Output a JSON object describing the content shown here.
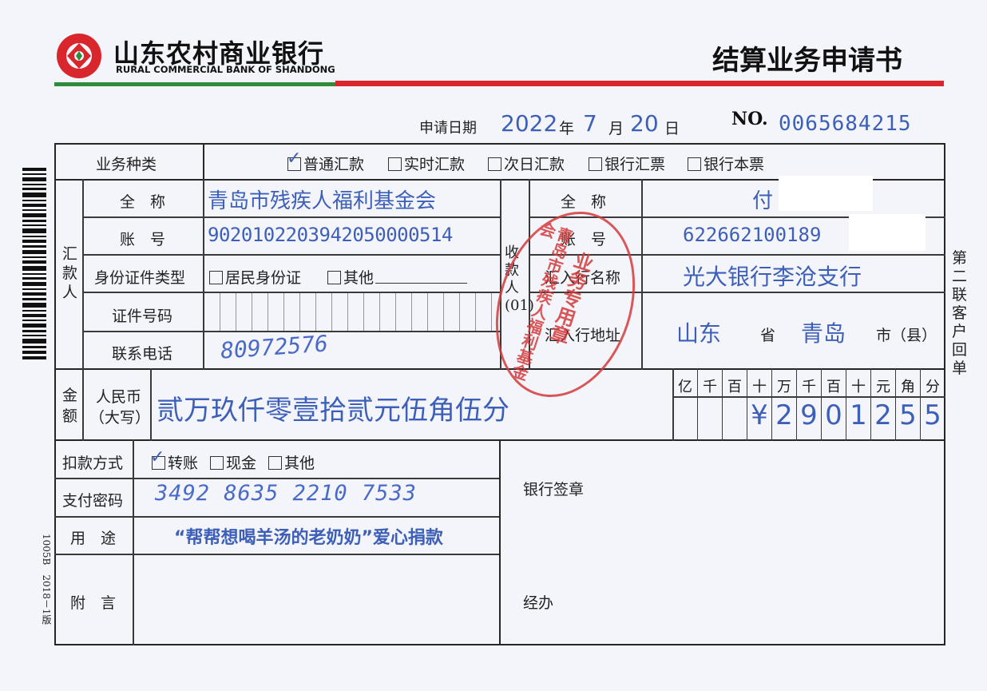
{
  "bank": {
    "name_cn": "山东农村商业银行",
    "name_en": "RURAL COMMERCIAL BANK OF SHANDONG",
    "colors": {
      "red": "#d9262c",
      "green": "#2e8b3a",
      "ink": "#3d5fb8"
    }
  },
  "doc_title": "结算业务申请书",
  "header": {
    "date_label": "申请日期",
    "year": "2022",
    "year_unit": "年",
    "month": "7",
    "month_unit": "月",
    "day": "20",
    "day_unit": "日",
    "no_label": "NO.",
    "no_value": "0065684215"
  },
  "business_type": {
    "label": "业务种类",
    "options": [
      "普通汇款",
      "实时汇款",
      "次日汇款",
      "银行汇票",
      "银行本票"
    ],
    "checked": "普通汇款"
  },
  "remitter": {
    "section_label": "汇款人",
    "name_label": "全　称",
    "name": "青岛市残疾人福利基金会",
    "account_label": "账　号",
    "account": "902010220394205000051​4",
    "id_type_label": "身份证件类型",
    "id_type_options": [
      "居民身份证",
      "其他"
    ],
    "id_no_label": "证件号码",
    "phone_label": "联系电话",
    "phone": "80972576"
  },
  "payee": {
    "section_label": "收款人(01)",
    "name_label": "全　称",
    "name": "付",
    "account_label": "账　号",
    "account": "622662100189",
    "bank_label": "汇入行名称",
    "bank": "光大银行李沧支行",
    "address_label": "汇入行地址",
    "province": "山东",
    "province_unit": "省",
    "city": "青岛",
    "city_unit": "市（县）"
  },
  "amount": {
    "label": "金额",
    "currency_label": "人民币",
    "uppercase_label": "（大写）",
    "words": "贰万玖仟零壹拾贰元伍角伍分",
    "digit_headers": [
      "亿",
      "千",
      "百",
      "十",
      "万",
      "千",
      "百",
      "十",
      "元",
      "角",
      "分"
    ],
    "figures": [
      "",
      "",
      "",
      "¥",
      "2",
      "9",
      "0",
      "1",
      "2",
      "5",
      "5"
    ]
  },
  "payment": {
    "method_label": "扣款方式",
    "method_options": [
      "转账",
      "现金",
      "其他"
    ],
    "method_checked": "转账",
    "password_label": "支付密码",
    "password": "3492 8635 2210 7533",
    "purpose_label": "用　途",
    "purpose": "“帮帮想喝羊汤的老奶奶”爱心捐款",
    "remark_label": "附　言",
    "bank_seal_label": "银行签章",
    "handler_label": "经办"
  },
  "stamp": {
    "lines": [
      "青岛市残疾人福利基金会",
      "业务专用章"
    ]
  },
  "side": {
    "copy_label": "第二联　客户回单",
    "form_code": "1005B　2018－1版"
  }
}
